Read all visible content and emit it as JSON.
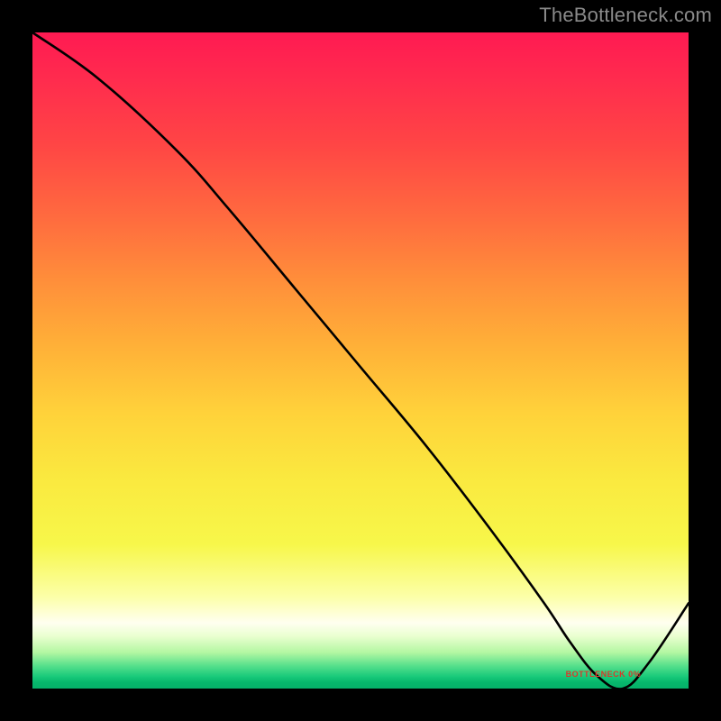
{
  "attribution": "TheBottleneck.com",
  "chart_data": {
    "type": "line",
    "title": "",
    "xlabel": "",
    "ylabel": "",
    "xlim": [
      0,
      100
    ],
    "ylim": [
      0,
      100
    ],
    "series": [
      {
        "name": "bottleneck-curve",
        "x": [
          0,
          10,
          22,
          30,
          40,
          50,
          60,
          70,
          78,
          82,
          86,
          90,
          94,
          100
        ],
        "values": [
          100,
          93,
          82,
          73,
          61,
          49,
          37,
          24,
          13,
          7,
          2,
          0,
          4,
          13
        ]
      }
    ],
    "annotations": [
      {
        "name": "minimum-label",
        "text": "BOTTLENECK 0%",
        "x": 87,
        "y": 1.5
      }
    ],
    "background_gradient": {
      "top": "#ff1a52",
      "middle": "#ffd23a",
      "bottom": "#05b169"
    }
  }
}
